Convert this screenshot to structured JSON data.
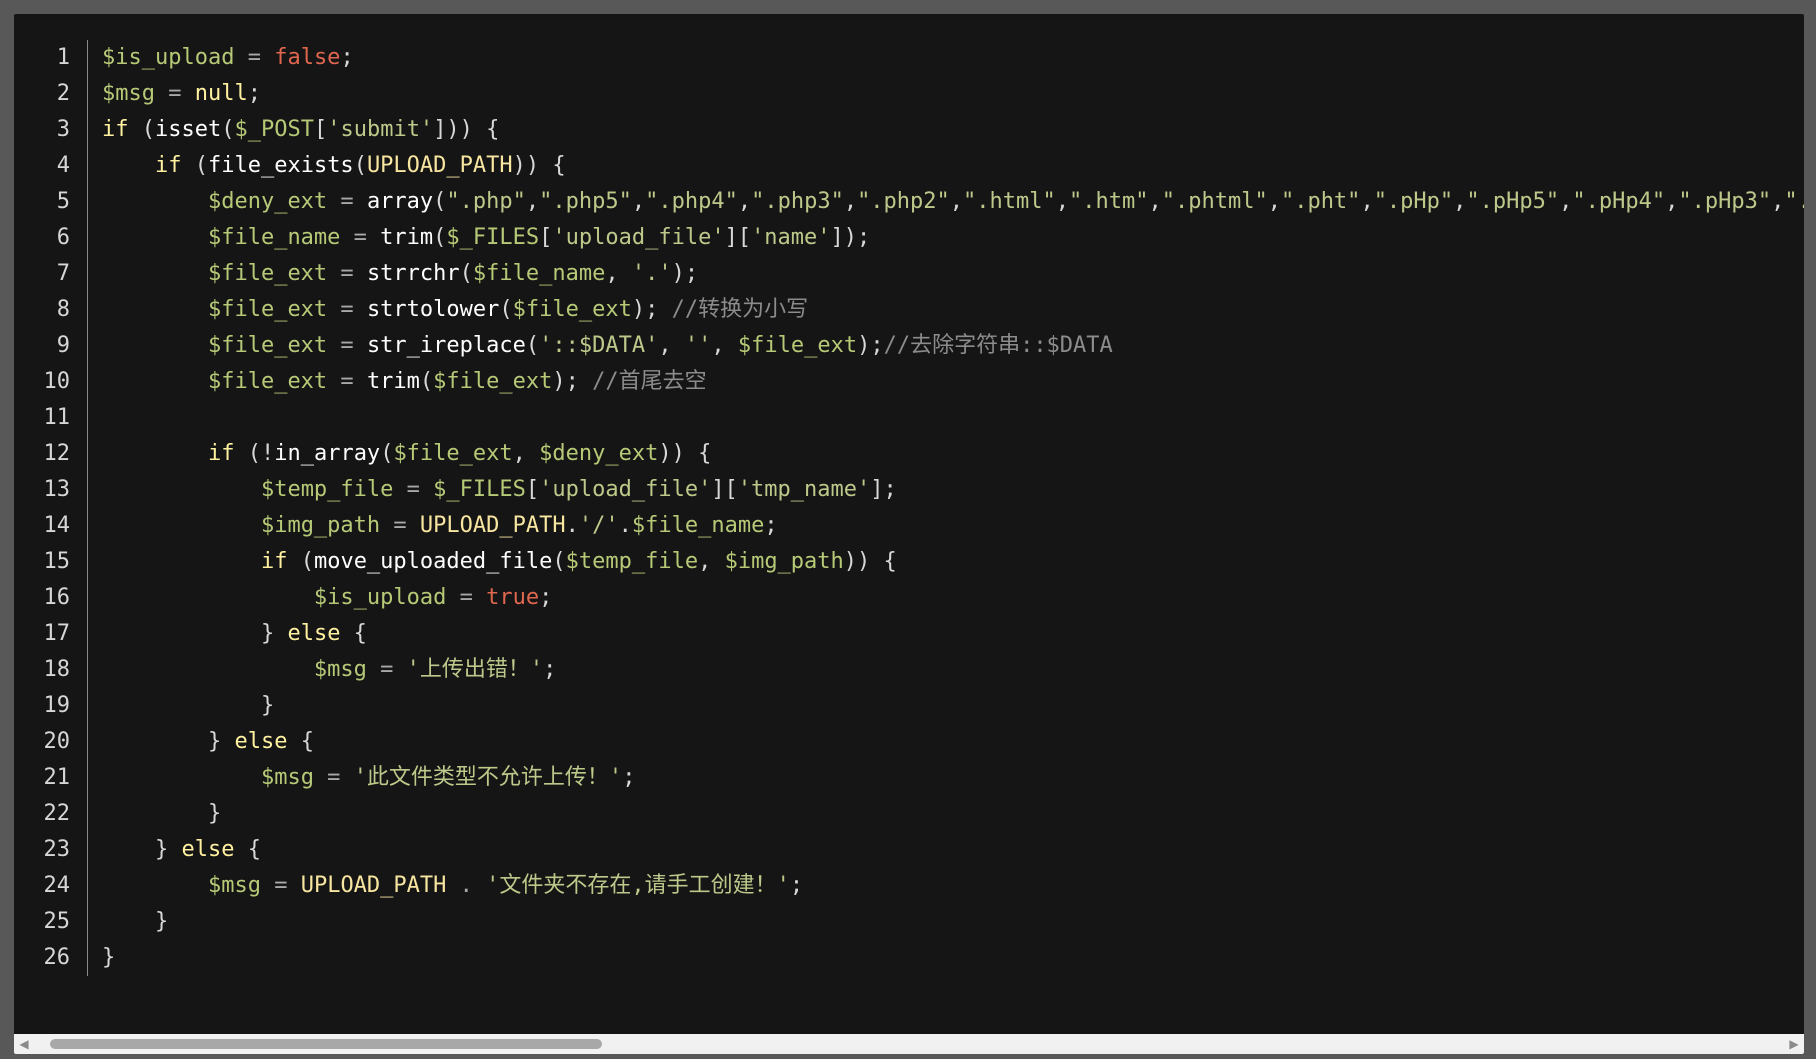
{
  "scrollbar": {
    "left_arrow": "◀",
    "right_arrow": "▶"
  },
  "lines": [
    {
      "n": "1",
      "tokens": [
        [
          "var",
          "$is_upload"
        ],
        [
          "op",
          " = "
        ],
        [
          "bool",
          "false"
        ],
        [
          "punc",
          ";"
        ]
      ]
    },
    {
      "n": "2",
      "tokens": [
        [
          "var",
          "$msg"
        ],
        [
          "op",
          " = "
        ],
        [
          "kw",
          "null"
        ],
        [
          "punc",
          ";"
        ]
      ]
    },
    {
      "n": "3",
      "tokens": [
        [
          "kw",
          "if"
        ],
        [
          "punc",
          " ("
        ],
        [
          "fn",
          "isset"
        ],
        [
          "punc",
          "("
        ],
        [
          "var",
          "$_POST"
        ],
        [
          "punc",
          "["
        ],
        [
          "str",
          "'submit'"
        ],
        [
          "punc",
          "])) {"
        ]
      ]
    },
    {
      "n": "4",
      "tokens": [
        [
          "plain",
          "    "
        ],
        [
          "kw",
          "if"
        ],
        [
          "punc",
          " ("
        ],
        [
          "fn",
          "file_exists"
        ],
        [
          "punc",
          "("
        ],
        [
          "const",
          "UPLOAD_PATH"
        ],
        [
          "punc",
          ")) {"
        ]
      ]
    },
    {
      "n": "5",
      "tokens": [
        [
          "plain",
          "        "
        ],
        [
          "var",
          "$deny_ext"
        ],
        [
          "op",
          " = "
        ],
        [
          "fn",
          "array"
        ],
        [
          "punc",
          "("
        ],
        [
          "str",
          "\".php\""
        ],
        [
          "punc",
          ","
        ],
        [
          "str",
          "\".php5\""
        ],
        [
          "punc",
          ","
        ],
        [
          "str",
          "\".php4\""
        ],
        [
          "punc",
          ","
        ],
        [
          "str",
          "\".php3\""
        ],
        [
          "punc",
          ","
        ],
        [
          "str",
          "\".php2\""
        ],
        [
          "punc",
          ","
        ],
        [
          "str",
          "\".html\""
        ],
        [
          "punc",
          ","
        ],
        [
          "str",
          "\".htm\""
        ],
        [
          "punc",
          ","
        ],
        [
          "str",
          "\".phtml\""
        ],
        [
          "punc",
          ","
        ],
        [
          "str",
          "\".pht\""
        ],
        [
          "punc",
          ","
        ],
        [
          "str",
          "\".pHp\""
        ],
        [
          "punc",
          ","
        ],
        [
          "str",
          "\".pHp5\""
        ],
        [
          "punc",
          ","
        ],
        [
          "str",
          "\".pHp4\""
        ],
        [
          "punc",
          ","
        ],
        [
          "str",
          "\".pHp3\""
        ],
        [
          "punc",
          ","
        ],
        [
          "str",
          "\"."
        ]
      ]
    },
    {
      "n": "6",
      "tokens": [
        [
          "plain",
          "        "
        ],
        [
          "var",
          "$file_name"
        ],
        [
          "op",
          " = "
        ],
        [
          "fn",
          "trim"
        ],
        [
          "punc",
          "("
        ],
        [
          "var",
          "$_FILES"
        ],
        [
          "punc",
          "["
        ],
        [
          "str",
          "'upload_file'"
        ],
        [
          "punc",
          "]["
        ],
        [
          "str",
          "'name'"
        ],
        [
          "punc",
          "]);"
        ]
      ]
    },
    {
      "n": "7",
      "tokens": [
        [
          "plain",
          "        "
        ],
        [
          "var",
          "$file_ext"
        ],
        [
          "op",
          " = "
        ],
        [
          "fn",
          "strrchr"
        ],
        [
          "punc",
          "("
        ],
        [
          "var",
          "$file_name"
        ],
        [
          "punc",
          ", "
        ],
        [
          "str",
          "'.'"
        ],
        [
          "punc",
          ");"
        ]
      ]
    },
    {
      "n": "8",
      "tokens": [
        [
          "plain",
          "        "
        ],
        [
          "var",
          "$file_ext"
        ],
        [
          "op",
          " = "
        ],
        [
          "fn",
          "strtolower"
        ],
        [
          "punc",
          "("
        ],
        [
          "var",
          "$file_ext"
        ],
        [
          "punc",
          "); "
        ],
        [
          "cmt",
          "//转换为小写"
        ]
      ]
    },
    {
      "n": "9",
      "tokens": [
        [
          "plain",
          "        "
        ],
        [
          "var",
          "$file_ext"
        ],
        [
          "op",
          " = "
        ],
        [
          "fn",
          "str_ireplace"
        ],
        [
          "punc",
          "("
        ],
        [
          "str",
          "'::$DATA'"
        ],
        [
          "punc",
          ", "
        ],
        [
          "str",
          "''"
        ],
        [
          "punc",
          ", "
        ],
        [
          "var",
          "$file_ext"
        ],
        [
          "punc",
          ");"
        ],
        [
          "cmt",
          "//去除字符串::$DATA"
        ]
      ]
    },
    {
      "n": "10",
      "tokens": [
        [
          "plain",
          "        "
        ],
        [
          "var",
          "$file_ext"
        ],
        [
          "op",
          " = "
        ],
        [
          "fn",
          "trim"
        ],
        [
          "punc",
          "("
        ],
        [
          "var",
          "$file_ext"
        ],
        [
          "punc",
          "); "
        ],
        [
          "cmt",
          "//首尾去空"
        ]
      ]
    },
    {
      "n": "11",
      "tokens": []
    },
    {
      "n": "12",
      "tokens": [
        [
          "plain",
          "        "
        ],
        [
          "kw",
          "if"
        ],
        [
          "punc",
          " (!"
        ],
        [
          "fn",
          "in_array"
        ],
        [
          "punc",
          "("
        ],
        [
          "var",
          "$file_ext"
        ],
        [
          "punc",
          ", "
        ],
        [
          "var",
          "$deny_ext"
        ],
        [
          "punc",
          ")) {"
        ]
      ]
    },
    {
      "n": "13",
      "tokens": [
        [
          "plain",
          "            "
        ],
        [
          "var",
          "$temp_file"
        ],
        [
          "op",
          " = "
        ],
        [
          "var",
          "$_FILES"
        ],
        [
          "punc",
          "["
        ],
        [
          "str",
          "'upload_file'"
        ],
        [
          "punc",
          "]["
        ],
        [
          "str",
          "'tmp_name'"
        ],
        [
          "punc",
          "];"
        ]
      ]
    },
    {
      "n": "14",
      "tokens": [
        [
          "plain",
          "            "
        ],
        [
          "var",
          "$img_path"
        ],
        [
          "op",
          " = "
        ],
        [
          "const",
          "UPLOAD_PATH"
        ],
        [
          "punc",
          "."
        ],
        [
          "str",
          "'/'"
        ],
        [
          "punc",
          "."
        ],
        [
          "var",
          "$file_name"
        ],
        [
          "punc",
          ";"
        ]
      ]
    },
    {
      "n": "15",
      "tokens": [
        [
          "plain",
          "            "
        ],
        [
          "kw",
          "if"
        ],
        [
          "punc",
          " ("
        ],
        [
          "fn",
          "move_uploaded_file"
        ],
        [
          "punc",
          "("
        ],
        [
          "var",
          "$temp_file"
        ],
        [
          "punc",
          ", "
        ],
        [
          "var",
          "$img_path"
        ],
        [
          "punc",
          ")) {"
        ]
      ]
    },
    {
      "n": "16",
      "tokens": [
        [
          "plain",
          "                "
        ],
        [
          "var",
          "$is_upload"
        ],
        [
          "op",
          " = "
        ],
        [
          "bool",
          "true"
        ],
        [
          "punc",
          ";"
        ]
      ]
    },
    {
      "n": "17",
      "tokens": [
        [
          "plain",
          "            "
        ],
        [
          "punc",
          "} "
        ],
        [
          "kw",
          "else"
        ],
        [
          "punc",
          " {"
        ]
      ]
    },
    {
      "n": "18",
      "tokens": [
        [
          "plain",
          "                "
        ],
        [
          "var",
          "$msg"
        ],
        [
          "op",
          " = "
        ],
        [
          "str",
          "'上传出错！'"
        ],
        [
          "punc",
          ";"
        ]
      ]
    },
    {
      "n": "19",
      "tokens": [
        [
          "plain",
          "            "
        ],
        [
          "punc",
          "}"
        ]
      ]
    },
    {
      "n": "20",
      "tokens": [
        [
          "plain",
          "        "
        ],
        [
          "punc",
          "} "
        ],
        [
          "kw",
          "else"
        ],
        [
          "punc",
          " {"
        ]
      ]
    },
    {
      "n": "21",
      "tokens": [
        [
          "plain",
          "            "
        ],
        [
          "var",
          "$msg"
        ],
        [
          "op",
          " = "
        ],
        [
          "str",
          "'此文件类型不允许上传！'"
        ],
        [
          "punc",
          ";"
        ]
      ]
    },
    {
      "n": "22",
      "tokens": [
        [
          "plain",
          "        "
        ],
        [
          "punc",
          "}"
        ]
      ]
    },
    {
      "n": "23",
      "tokens": [
        [
          "plain",
          "    "
        ],
        [
          "punc",
          "} "
        ],
        [
          "kw",
          "else"
        ],
        [
          "punc",
          " {"
        ]
      ]
    },
    {
      "n": "24",
      "tokens": [
        [
          "plain",
          "        "
        ],
        [
          "var",
          "$msg"
        ],
        [
          "op",
          " = "
        ],
        [
          "const",
          "UPLOAD_PATH"
        ],
        [
          "op",
          " . "
        ],
        [
          "str",
          "'文件夹不存在,请手工创建！'"
        ],
        [
          "punc",
          ";"
        ]
      ]
    },
    {
      "n": "25",
      "tokens": [
        [
          "plain",
          "    "
        ],
        [
          "punc",
          "}"
        ]
      ]
    },
    {
      "n": "26",
      "tokens": [
        [
          "punc",
          "}"
        ]
      ]
    }
  ]
}
